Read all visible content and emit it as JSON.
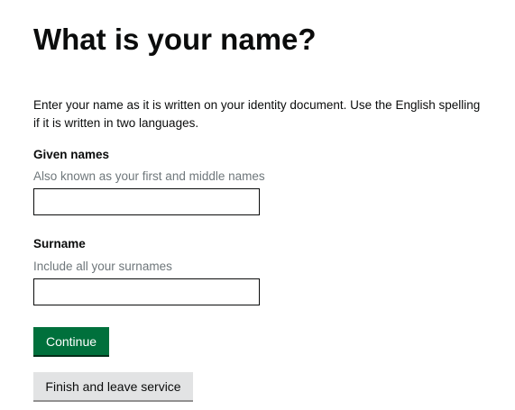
{
  "page": {
    "heading": "What is your name?",
    "intro": "Enter your name as it is written on your identity document. Use the English spelling if it is written in two languages."
  },
  "fields": {
    "given_names": {
      "label": "Given names",
      "hint": "Also known as your first and middle names",
      "value": ""
    },
    "surname": {
      "label": "Surname",
      "hint": "Include all your surnames",
      "value": ""
    }
  },
  "buttons": {
    "continue_label": "Continue",
    "finish_label": "Finish and leave service"
  },
  "colors": {
    "primary_button": "#00703c",
    "secondary_button": "#e2e3e4",
    "hint_text": "#6f777b",
    "text": "#0b0c0c"
  }
}
